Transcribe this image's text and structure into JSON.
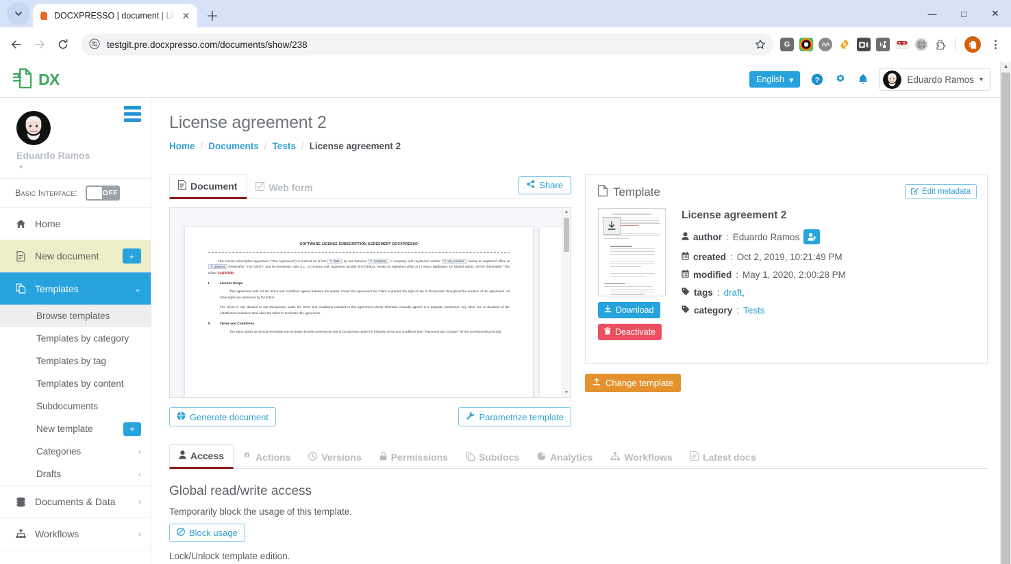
{
  "browser": {
    "tab": {
      "title": "DOCXPRESSO | document | Lice",
      "favicon_icon": "docxpresso-favicon",
      "close_icon": "close-icon"
    },
    "tab_chevron_icon": "chevron-down-icon",
    "new_tab_icon": "plus-icon",
    "window": {
      "minimize": "—",
      "maximize": "□",
      "close": "✕"
    },
    "nav": {
      "back_icon": "arrow-left-icon",
      "forward_icon": "arrow-right-icon",
      "reload_icon": "reload-icon"
    },
    "omnibox": {
      "site_settings_icon": "page-settings-icon",
      "url": "testgit.pre.docxpresso.com/documents/show/238",
      "star_icon": "bookmark-star-icon"
    },
    "extensions": [
      {
        "name": "grammarly-extension-icon",
        "letter": "G",
        "color": "#6e6e6e"
      },
      {
        "name": "colorful-circle-extension-icon",
        "letter": "",
        "color": "#222222"
      },
      {
        "name": "wave-extension-icon",
        "letter": "",
        "color": "#707070"
      },
      {
        "name": "gear-orange-extension-icon",
        "letter": "",
        "color": "#f0a015"
      },
      {
        "name": "camera-extension-icon",
        "letter": "",
        "color": "#4a4a4a"
      },
      {
        "name": "hubspot-extension-icon",
        "letter": "",
        "color": "#6f6f6f"
      },
      {
        "name": "lastpass-mask-extension-icon",
        "letter": "",
        "color": "#d9534f"
      },
      {
        "name": "profile-globe-icon",
        "letter": "",
        "color": "#8d8d8d"
      },
      {
        "name": "puzzle-extensions-icon",
        "letter": "",
        "color": "#5f6368"
      }
    ],
    "profile_icon": "docxpresso-profile-avatar",
    "menu_icon": "kebab-menu-icon"
  },
  "header": {
    "brand": "DX",
    "brand_icon": "docxpresso-logo-icon",
    "brand_color": "#3aab5c",
    "language": {
      "label": "English",
      "caret_icon": "caret-down-icon"
    },
    "help_icon": "help-circle-icon",
    "settings_icon": "gear-icon",
    "notifications_icon": "bell-icon",
    "user": {
      "name": "Eduardo Ramos",
      "avatar_icon": "user-avatar",
      "caret_icon": "caret-down-icon"
    }
  },
  "sidebar": {
    "user_name": "Eduardo Ramos",
    "user_avatar_icon": "user-avatar",
    "burger_icon": "hamburger-menu-icon",
    "caret_icon": "caret-down-icon",
    "basic_interface": {
      "label": "Basic Interface:",
      "state": "OFF"
    },
    "items": [
      {
        "label": "Home",
        "icon": "home-icon",
        "style": "plain"
      },
      {
        "label": "New document",
        "icon": "file-document-icon",
        "style": "highlight",
        "badge": "+"
      },
      {
        "label": "Templates",
        "icon": "copy-templates-icon",
        "style": "active",
        "chevron": "chevron-down-icon"
      }
    ],
    "sub_items": [
      {
        "label": "Browse templates",
        "selected": true
      },
      {
        "label": "Templates by category",
        "selected": false
      },
      {
        "label": "Templates by tag",
        "selected": false
      },
      {
        "label": "Templates by content",
        "selected": false
      },
      {
        "label": "Subdocuments",
        "selected": false
      },
      {
        "label": "New template",
        "selected": false,
        "badge": "+"
      },
      {
        "label": "Categories",
        "selected": false,
        "chevron": "chevron-left-icon"
      },
      {
        "label": "Drafts",
        "selected": false,
        "chevron": "chevron-left-icon"
      }
    ],
    "bottom_items": [
      {
        "label": "Documents & Data",
        "icon": "database-icon",
        "chevron": "chevron-left-icon"
      },
      {
        "label": "Workflows",
        "icon": "sitemap-icon",
        "chevron": "chevron-left-icon"
      }
    ]
  },
  "main": {
    "title": "License agreement 2",
    "breadcrumb": [
      {
        "label": "Home",
        "current": false
      },
      {
        "label": "Documents",
        "current": false
      },
      {
        "label": "Tests",
        "current": false
      },
      {
        "label": "License agreement 2",
        "current": true
      }
    ],
    "tabs": [
      {
        "label": "Document",
        "icon": "file-document-icon",
        "active": true
      },
      {
        "label": "Web form",
        "icon": "checked-box-icon",
        "active": false
      }
    ],
    "share_button": {
      "label": "Share",
      "icon": "share-icon"
    },
    "preview": {
      "heading": "SOFTWARE LICENSE SUBSCRIPTION AGREEMENT DOCXPRESSO",
      "para1_a": "This license subscription agreement (\"The Agreement\") is entered as of this",
      "field_date": "date",
      "para1_b": ", by and between",
      "field_company": "company",
      "para1_c": ", a company with registered number",
      "field_vat": "vat_number",
      "para1_d": ", having its registered office at",
      "field_address": "address",
      "para1_e": "(hereinafter \"The Client\"), and No-Nonsense Labs S.L., a company with registered number B-87039822, having its registered office at C/ Arturo Baldasano 18, Madrid 28043, SPAIN (hereinafter \"The Editor\")",
      "para1_red": "jughkjhjkh",
      "sec1_num": "I.",
      "sec1_title": "License Scope",
      "sec1_p1": "This agreement sets out the terms and conditions agreed between the parties. Under this agreement the Client is granted the right of use of Docxpresso throughout the duration of the agreement. All other rights are preserved by the Editor.",
      "sec1_p2": "The Client is only allowed to use Docxpresso under the terms and conditions included in this agreement unless otherwise mutually agreed in a separate instrument. Any other use or deviation of the established conditions shall allow the Editor to terminate this agreement.",
      "sec2_num": "II.",
      "sec2_title": "Terms and Conditions",
      "sec2_p1": "The editor grants an annual renewable non exclusive license covering the use of Docxpresso under the following terms and conditions (see \"Payments and Charges\" for the corresponding pricing):"
    },
    "generate_button": {
      "label": "Generate document",
      "icon": "globe-gear-icon"
    },
    "parametrize_button": {
      "label": "Parametrize template",
      "icon": "wrench-icon"
    },
    "template_panel": {
      "title": "Template",
      "title_icon": "file-outline-icon",
      "edit_metadata": {
        "label": "Edit metadata",
        "icon": "pencil-square-icon"
      },
      "thumb_download_icon": "download-icon",
      "download_button": {
        "label": "Download",
        "icon": "download-icon"
      },
      "deactivate_button": {
        "label": "Deactivate",
        "icon": "trash-icon"
      },
      "name": "License agreement 2",
      "fields": [
        {
          "icon": "user-icon",
          "label": "author",
          "value": "Eduardo Ramos",
          "badge_icon": "add-user-icon",
          "link": false
        },
        {
          "icon": "calendar-icon",
          "label": "created",
          "value": "Oct 2, 2019, 10:21:49 PM",
          "link": false
        },
        {
          "icon": "calendar-icon",
          "label": "modified",
          "value": "May 1, 2020, 2:00:28 PM",
          "link": false
        },
        {
          "icon": "tag-icon",
          "label": "tags",
          "value": "draft,",
          "link": true
        },
        {
          "icon": "tag-icon",
          "label": "category",
          "value": "Tests",
          "link": true
        }
      ]
    },
    "change_template_button": {
      "label": "Change template",
      "icon": "upload-icon"
    },
    "bottom_tabs": [
      {
        "label": "Access",
        "icon": "user-icon",
        "active": true
      },
      {
        "label": "Actions",
        "icon": "gear-icon",
        "active": false
      },
      {
        "label": "Versions",
        "icon": "clock-icon",
        "active": false
      },
      {
        "label": "Permissions",
        "icon": "lock-icon",
        "active": false
      },
      {
        "label": "Subdocs",
        "icon": "copy-icon",
        "active": false
      },
      {
        "label": "Analytics",
        "icon": "pie-chart-icon",
        "active": false
      },
      {
        "label": "Workflows",
        "icon": "sitemap-icon",
        "active": false
      },
      {
        "label": "Latest docs",
        "icon": "file-document-icon",
        "active": false
      }
    ],
    "access_section": {
      "heading": "Global read/write access",
      "description": "Temporarily block the usage of this template.",
      "block_button": {
        "label": "Block usage",
        "icon": "ban-icon"
      },
      "lock_text": "Lock/Unlock template edition."
    }
  }
}
